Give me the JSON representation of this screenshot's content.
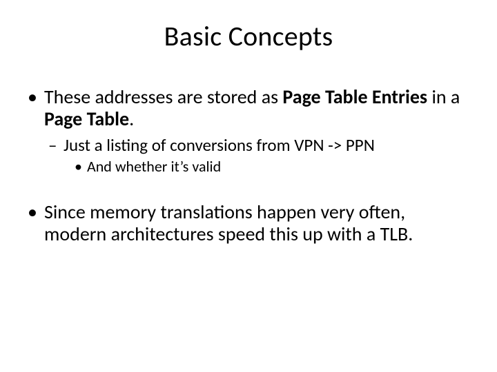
{
  "title": "Basic Concepts",
  "bullets": {
    "l1a_pre": "These addresses are stored as ",
    "l1a_bold1": "Page Table Entries",
    "l1a_mid": " in a ",
    "l1a_bold2": "Page Table",
    "l1a_post": ".",
    "l2a": "Just a listing of conversions from VPN -> PPN",
    "l3a": "And whether it’s valid",
    "l1b": "Since memory translations happen very often, modern architectures speed this up with a TLB."
  }
}
